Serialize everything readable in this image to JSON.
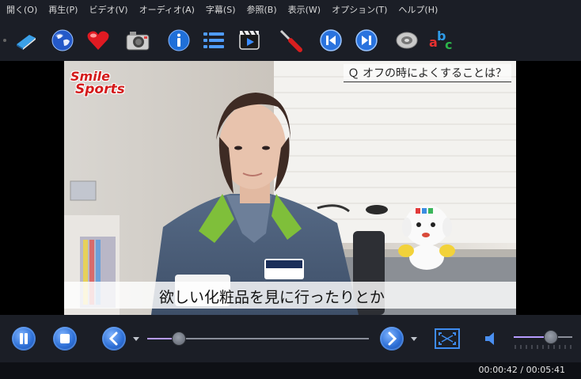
{
  "menu": [
    {
      "label": "開く(O)"
    },
    {
      "label": "再生(P)"
    },
    {
      "label": "ビデオ(V)"
    },
    {
      "label": "オーディオ(A)"
    },
    {
      "label": "字幕(S)"
    },
    {
      "label": "参照(B)"
    },
    {
      "label": "表示(W)"
    },
    {
      "label": "オプション(T)"
    },
    {
      "label": "ヘルプ(H)"
    }
  ],
  "toolbar_icons": [
    "book-icon",
    "globe-icon",
    "heart-icon",
    "camera-icon",
    "info-icon",
    "list-icon",
    "film-icon",
    "screwdriver-icon",
    "previous-icon",
    "next-icon",
    "disc-icon",
    "abc-icon"
  ],
  "video": {
    "logo_line1": "Smile",
    "logo_line2": "Sports",
    "question": "Ｑ オフの時によくすることは？",
    "subtitle": "欲しい化粧品を見に行ったりとか"
  },
  "controls": {
    "seek_position": 0.14,
    "volume_level": 0.62
  },
  "status": {
    "time": "00:00:42 / 00:05:41"
  },
  "colors": {
    "accent": "#b69bff",
    "button_blue": "#2d6fd6"
  }
}
